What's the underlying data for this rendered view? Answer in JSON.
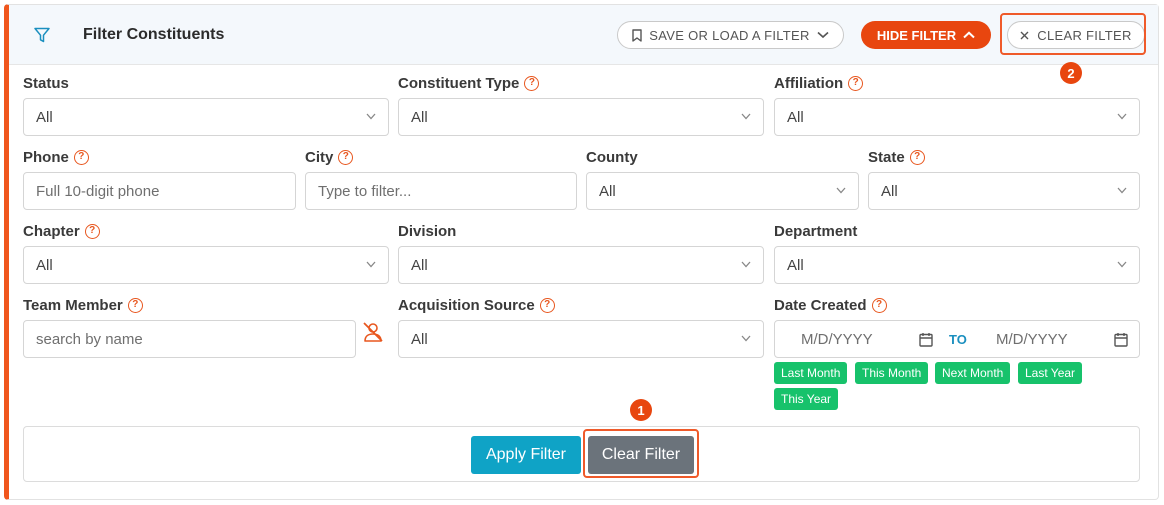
{
  "header": {
    "title": "Filter Constituents",
    "save_load_label": "SAVE OR LOAD A FILTER",
    "hide_filter_label": "HIDE FILTER",
    "clear_filter_label": "CLEAR FILTER"
  },
  "fields": {
    "status": {
      "label": "Status",
      "value": "All"
    },
    "constituent_type": {
      "label": "Constituent Type",
      "value": "All"
    },
    "affiliation": {
      "label": "Affiliation",
      "value": "All"
    },
    "phone": {
      "label": "Phone",
      "placeholder": "Full 10-digit phone"
    },
    "city": {
      "label": "City",
      "placeholder": "Type to filter..."
    },
    "county": {
      "label": "County",
      "value": "All"
    },
    "state": {
      "label": "State",
      "value": "All"
    },
    "chapter": {
      "label": "Chapter",
      "value": "All"
    },
    "division": {
      "label": "Division",
      "value": "All"
    },
    "department": {
      "label": "Department",
      "value": "All"
    },
    "team_member": {
      "label": "Team Member",
      "placeholder": "search by name"
    },
    "acquisition_source": {
      "label": "Acquisition Source",
      "value": "All"
    },
    "date_created": {
      "label": "Date Created",
      "from_placeholder": "M/D/YYYY",
      "to_label": "TO",
      "to_placeholder": "M/D/YYYY",
      "presets": [
        "Last Month",
        "This Month",
        "Next Month",
        "Last Year",
        "This Year"
      ]
    }
  },
  "footer": {
    "apply_label": "Apply Filter",
    "clear_label": "Clear Filter"
  },
  "annotations": {
    "badge_1": "1",
    "badge_2": "2"
  },
  "colors": {
    "accent": "#e8460f",
    "apply": "#0fa3c6",
    "clear": "#6b737b",
    "chip": "#17c26b",
    "link": "#1a8fbf"
  },
  "icons": {
    "header": "filter-icon",
    "save": "bookmark-icon",
    "hide": "chevron-up-icon",
    "clear": "close-icon",
    "help": "question-circle-icon",
    "select": "chevron-down-icon",
    "team": "user-slash-icon",
    "date": "calendar-icon"
  }
}
